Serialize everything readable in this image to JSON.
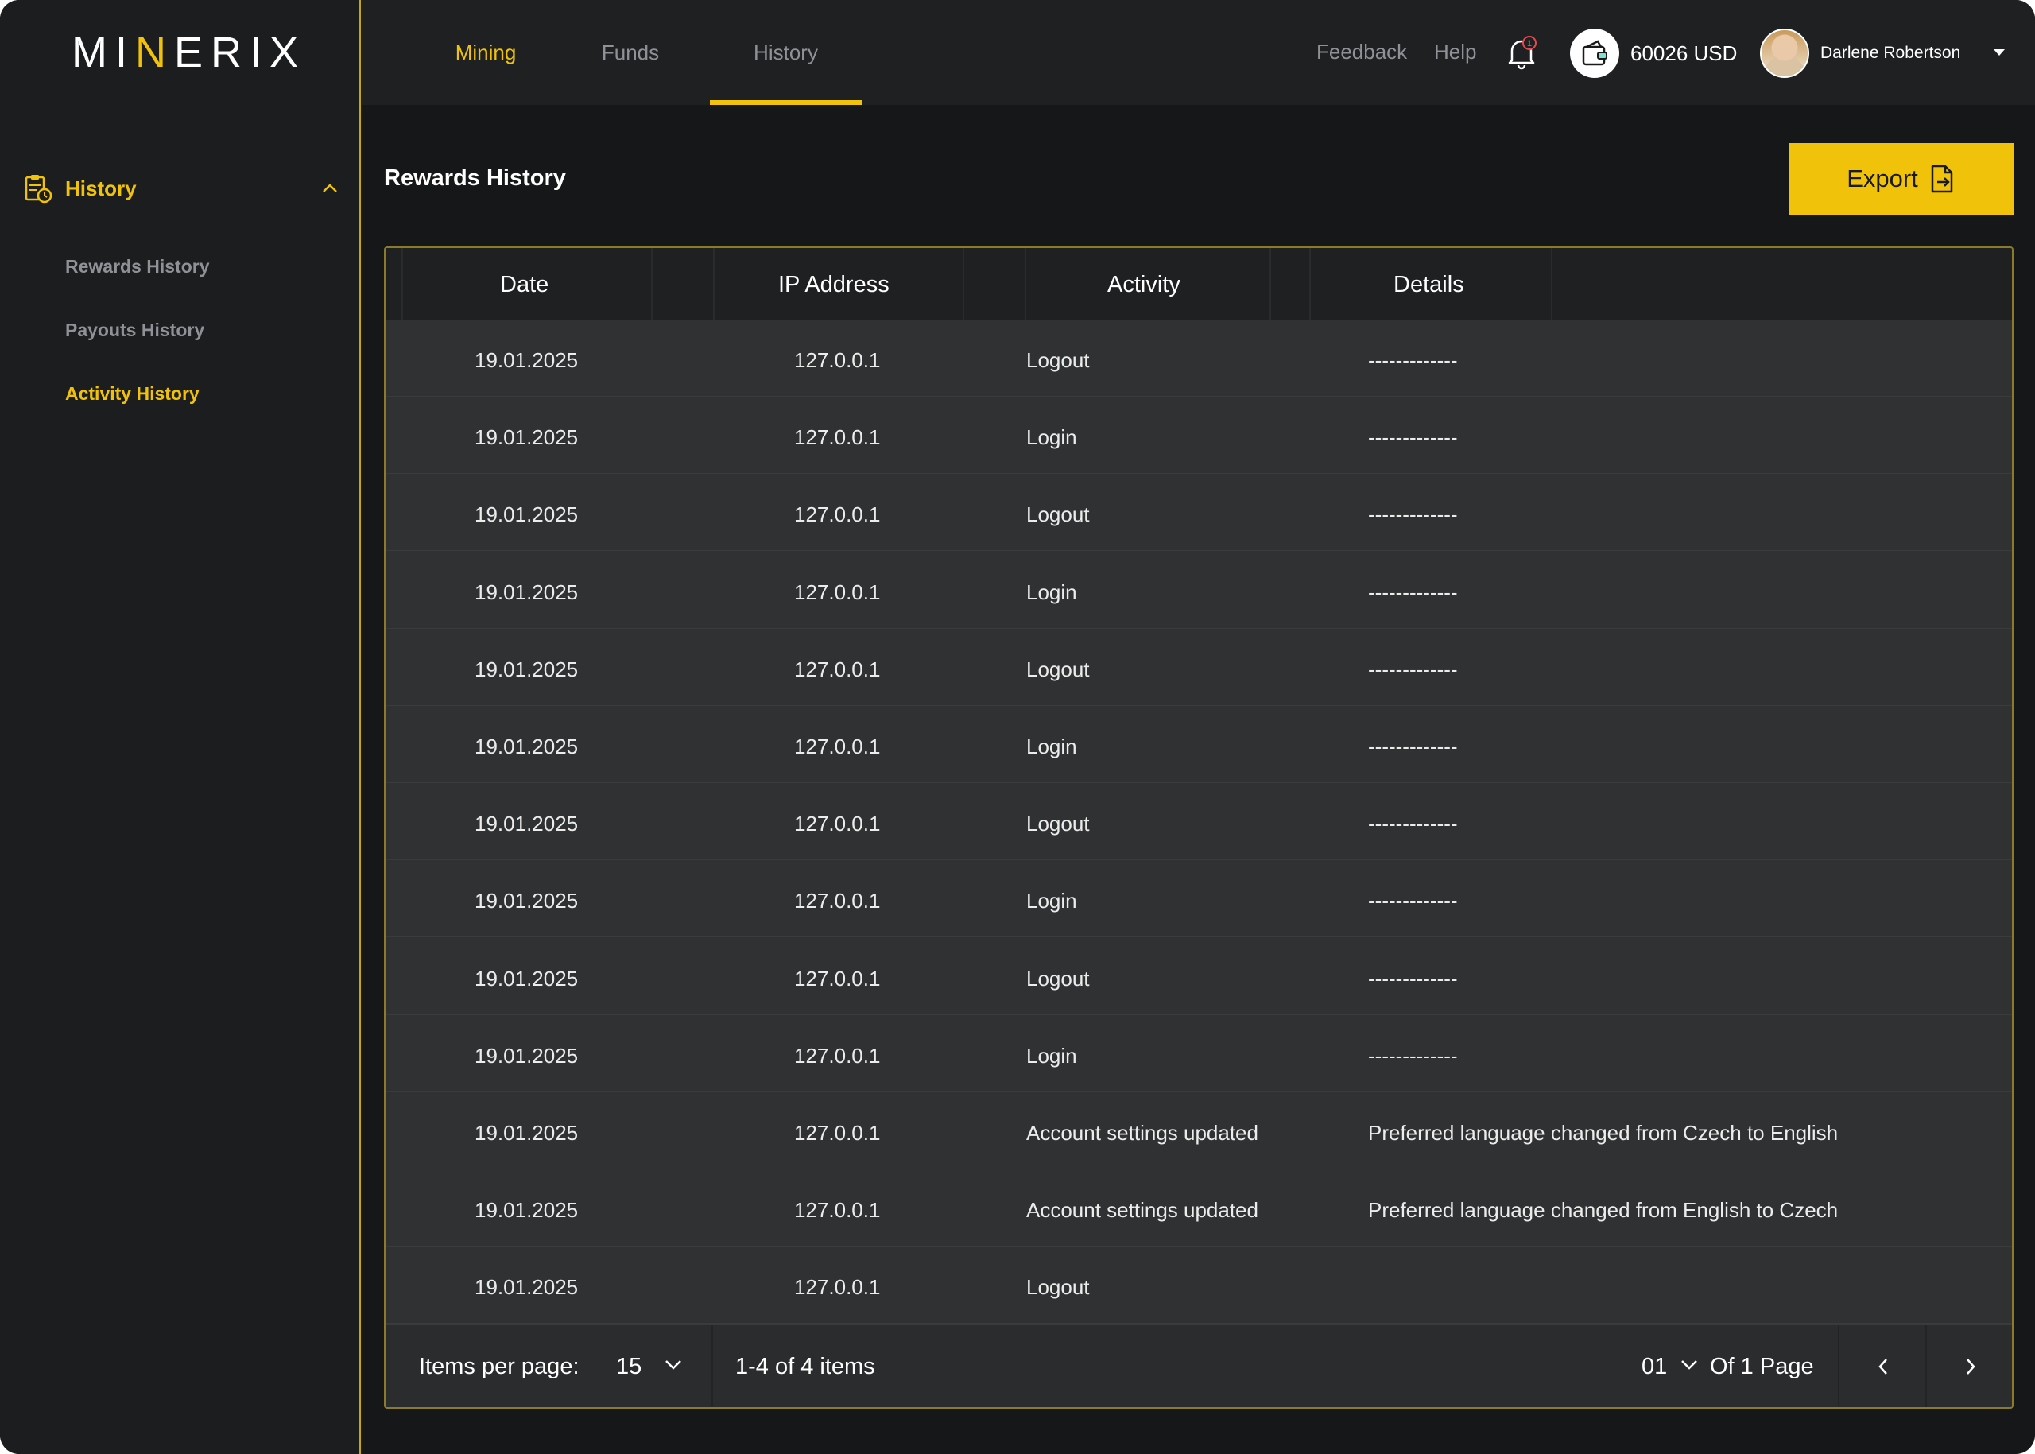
{
  "brand": {
    "logo_prefix": "MI",
    "logo_accent": "N",
    "logo_suffix": "ERIX"
  },
  "sidebar": {
    "section_label": "History",
    "items": [
      {
        "label": "Rewards History",
        "active": false
      },
      {
        "label": "Payouts History",
        "active": false
      },
      {
        "label": "Activity History",
        "active": true
      }
    ]
  },
  "topbar": {
    "tabs": [
      {
        "label": "Mining",
        "highlighted": true
      },
      {
        "label": "Funds",
        "highlighted": false
      },
      {
        "label": "History",
        "selected": true
      }
    ],
    "feedback": "Feedback",
    "help": "Help",
    "notification_count": "1",
    "balance": "60026 USD",
    "username": "Darlene Robertson"
  },
  "main": {
    "title": "Rewards History",
    "export_label": "Export",
    "columns": [
      "Date",
      "IP Address",
      "Activity",
      "Details"
    ],
    "rows": [
      {
        "date": "19.01.2025",
        "ip": "127.0.0.1",
        "activity": "Logout",
        "details": "-------------"
      },
      {
        "date": "19.01.2025",
        "ip": "127.0.0.1",
        "activity": "Login",
        "details": "-------------"
      },
      {
        "date": "19.01.2025",
        "ip": "127.0.0.1",
        "activity": "Logout",
        "details": "-------------"
      },
      {
        "date": "19.01.2025",
        "ip": "127.0.0.1",
        "activity": "Login",
        "details": "-------------"
      },
      {
        "date": "19.01.2025",
        "ip": "127.0.0.1",
        "activity": "Logout",
        "details": "-------------"
      },
      {
        "date": "19.01.2025",
        "ip": "127.0.0.1",
        "activity": "Login",
        "details": "-------------"
      },
      {
        "date": "19.01.2025",
        "ip": "127.0.0.1",
        "activity": "Logout",
        "details": "-------------"
      },
      {
        "date": "19.01.2025",
        "ip": "127.0.0.1",
        "activity": "Login",
        "details": "-------------"
      },
      {
        "date": "19.01.2025",
        "ip": "127.0.0.1",
        "activity": "Logout",
        "details": "-------------"
      },
      {
        "date": "19.01.2025",
        "ip": "127.0.0.1",
        "activity": "Login",
        "details": "-------------"
      },
      {
        "date": "19.01.2025",
        "ip": "127.0.0.1",
        "activity": "Account settings updated",
        "details": "Preferred language changed from Czech to English"
      },
      {
        "date": "19.01.2025",
        "ip": "127.0.0.1",
        "activity": "Account settings updated",
        "details": "Preferred language changed from English to Czech"
      },
      {
        "date": "19.01.2025",
        "ip": "127.0.0.1",
        "activity": "Logout",
        "details": ""
      }
    ],
    "pagination": {
      "items_per_page_label": "Items per page:",
      "items_per_page": "15",
      "range": "1-4 of 4 items",
      "page": "01",
      "of_pages": "Of 1 Page"
    }
  },
  "colors": {
    "accent": "#f0c30a",
    "bg": "#161718",
    "sidebar": "#1c1d1f",
    "row": "#303132"
  },
  "icons": [
    "history-clipboard-icon",
    "chevron-up-icon",
    "bell-icon",
    "wallet-icon",
    "export-file-icon",
    "chevron-down-icon",
    "chevron-left-icon",
    "chevron-right-icon"
  ]
}
